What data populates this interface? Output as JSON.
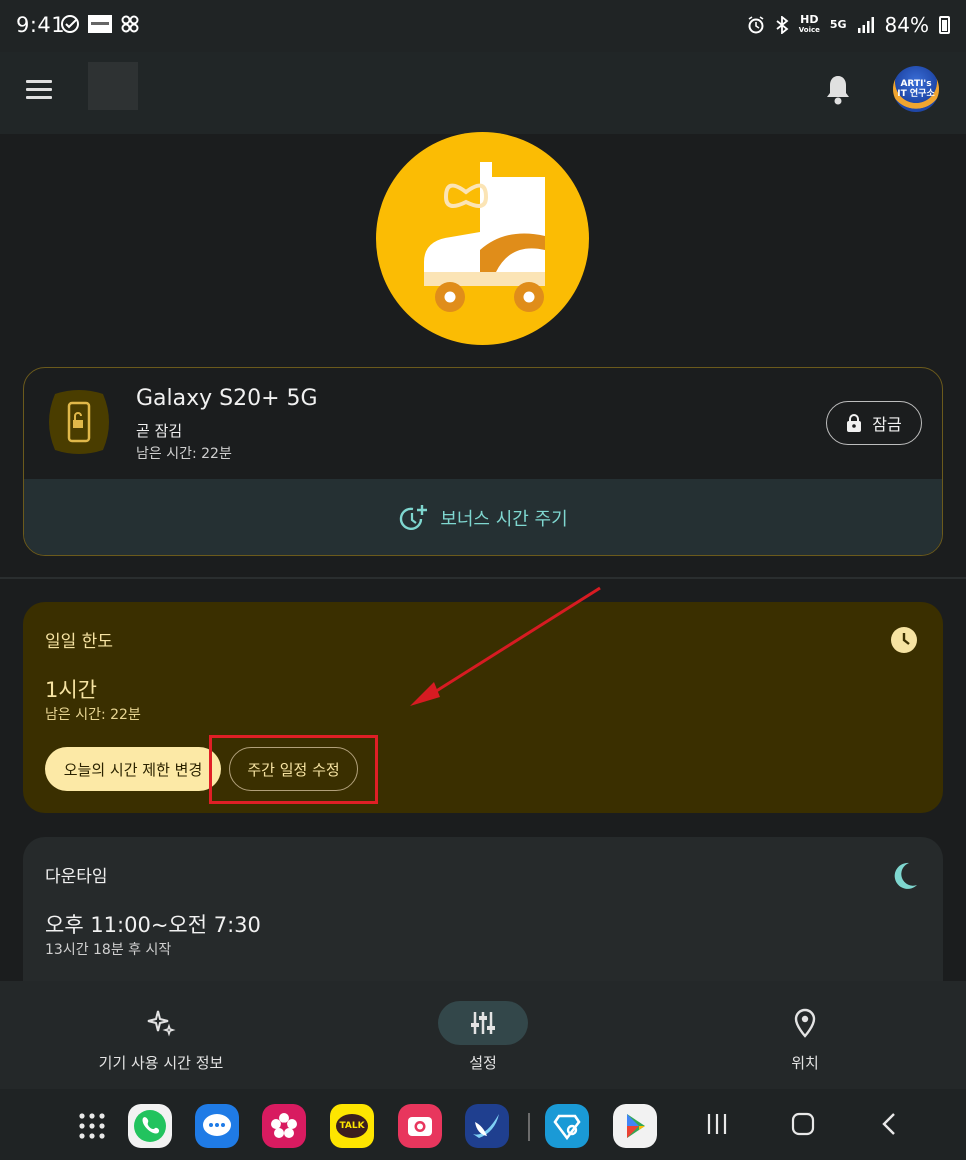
{
  "status_bar": {
    "time": "9:41",
    "left_icons": [
      "check-circle-icon",
      "news-badge-icon",
      "pinwheel-icon"
    ],
    "hd_voice_top": "HD",
    "hd_voice_bottom": "Voice",
    "network": "5G",
    "battery": "84%"
  },
  "app_bar": {
    "menu_icon": "menu-icon",
    "notifications_icon": "bell-icon",
    "avatar_line1": "ARTI's",
    "avatar_line2": "IT 연구소"
  },
  "hero": {
    "illustration": "roller-skate-icon",
    "bg_color": "#fbbc04"
  },
  "device": {
    "name": "Galaxy S20+ 5G",
    "status": "곧 잠김",
    "remaining": "남은 시간: 22분",
    "lock_label": "잠금",
    "bonus_label": "보너스 시간 주기"
  },
  "daily_limit": {
    "title": "일일 한도",
    "value": "1시간",
    "remaining": "남은 시간: 22분",
    "change_today_label": "오늘의 시간 제한 변경",
    "edit_weekly_label": "주간 일정 수정"
  },
  "downtime": {
    "title": "다운타임",
    "time_range": "오후 11:00~오전 7:30",
    "starts_in": "13시간 18분 후 시작"
  },
  "bottom_nav": {
    "items": [
      {
        "label": "기기 사용 시간 정보",
        "icon": "sparkle-icon",
        "active": false
      },
      {
        "label": "설정",
        "icon": "sliders-icon",
        "active": true
      },
      {
        "label": "위치",
        "icon": "location-pin-icon",
        "active": false
      }
    ]
  },
  "dock": {
    "apps": [
      "apps-grid-icon",
      "phone-app-icon",
      "messages-app-icon",
      "blossom-app-icon",
      "kakaotalk-app-icon",
      "camera-app-icon",
      "bird-app-icon",
      "link-app-icon",
      "play-store-icon"
    ],
    "kakao_label": "TALK",
    "system_nav": [
      "recents-icon",
      "home-icon",
      "back-icon"
    ]
  },
  "colors": {
    "accent_teal": "#7fd7d0",
    "limit_bg": "#3a2f00",
    "highlight_red": "#e01f26"
  }
}
